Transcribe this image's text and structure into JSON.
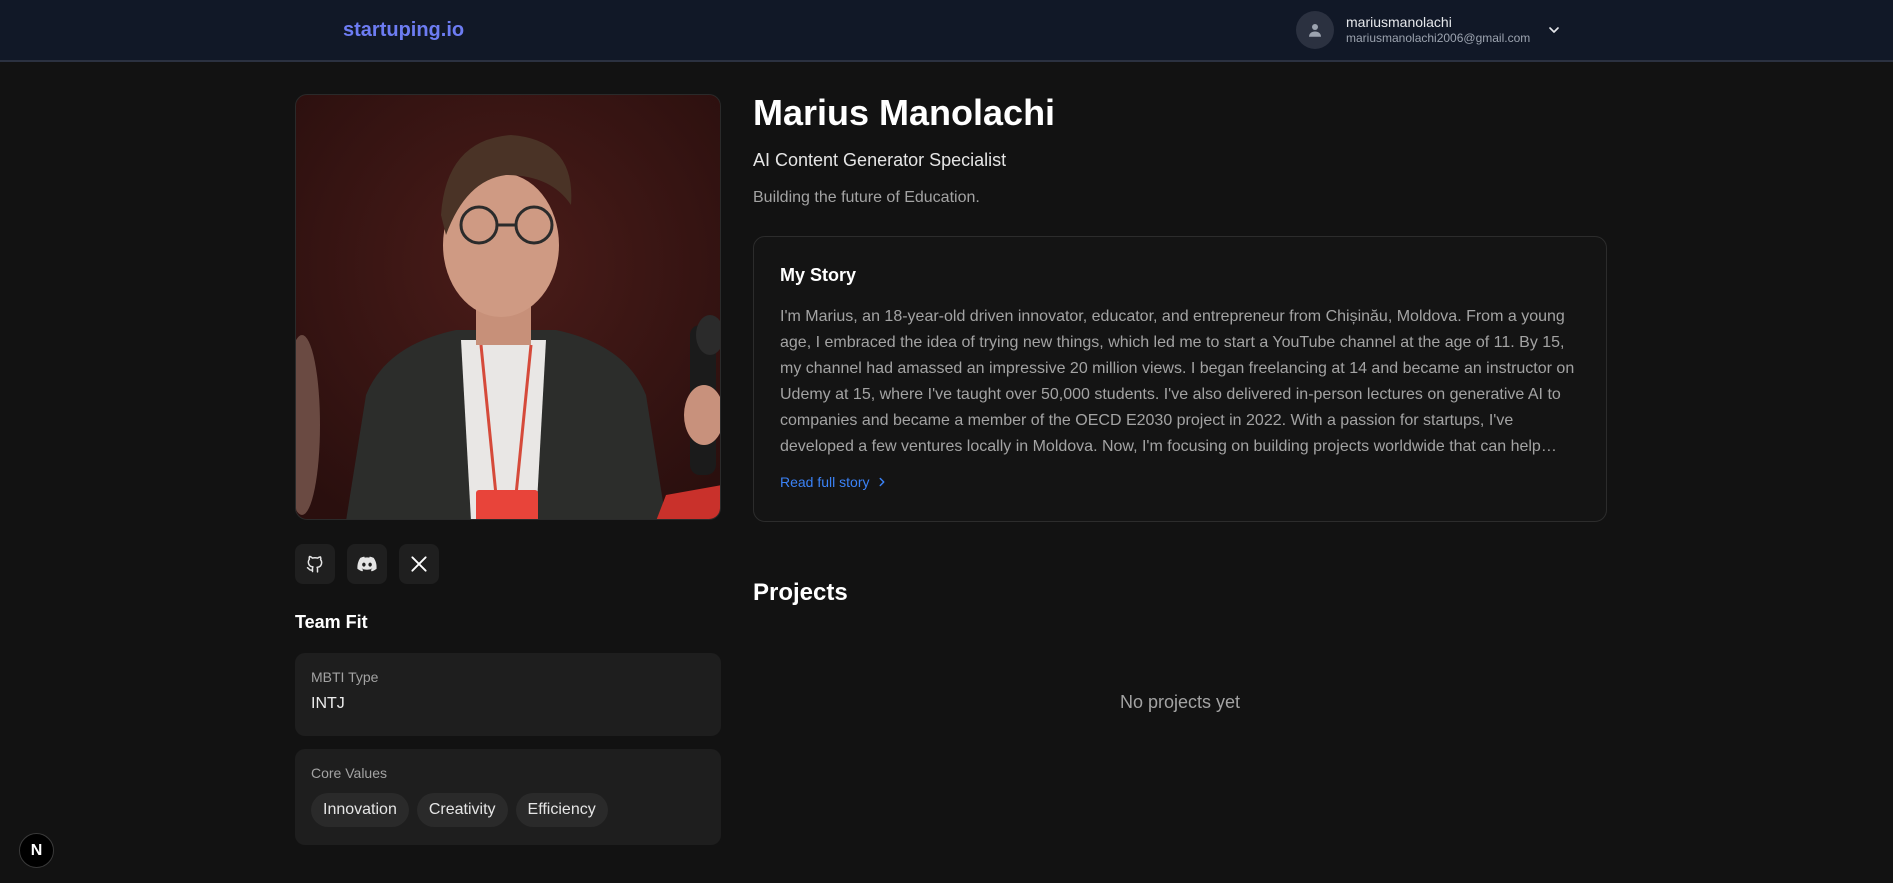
{
  "header": {
    "logo": "startuping.io",
    "user": {
      "name": "mariusmanolachi",
      "email": "mariusmanolachi2006@gmail.com"
    }
  },
  "profile": {
    "name": "Marius Manolachi",
    "title": "AI Content Generator Specialist",
    "tagline": "Building the future of Education."
  },
  "social": {
    "icons": [
      "github-icon",
      "discord-icon",
      "x-icon"
    ]
  },
  "team_fit": {
    "heading": "Team Fit",
    "mbti_label": "MBTI Type",
    "mbti_value": "INTJ",
    "values_label": "Core Values",
    "values": [
      "Innovation",
      "Creativity",
      "Efficiency"
    ]
  },
  "story": {
    "heading": "My Story",
    "text": "I'm Marius, an 18-year-old driven innovator, educator, and entrepreneur from Chișinău, Moldova. From a young age, I embraced the idea of trying new things, which led me to start a YouTube channel at the age of 11. By 15, my channel had amassed an impressive 20 million views. I began freelancing at 14 and became an instructor on Udemy at 15, where I've taught over 50,000 students. I've also delivered in-person lectures on generative AI to companies and became a member of the OECD E2030 project in 2022. With a passion for startups, I've developed a few ventures locally in Moldova. Now, I'm focusing on building projects worldwide that can help anyone.",
    "read_more": "Read full story"
  },
  "projects": {
    "heading": "Projects",
    "empty": "No projects yet"
  },
  "badge": "N",
  "colors": {
    "accent": "#6d7cf2",
    "link": "#3b82f6",
    "background": "#121212"
  }
}
